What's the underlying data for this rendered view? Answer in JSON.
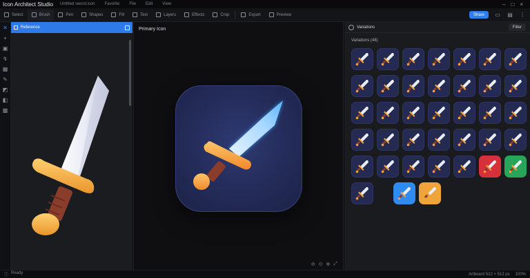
{
  "app": {
    "title": "Icon Architect Studio"
  },
  "menus": [
    "Untitled sword.icon",
    "Favorite",
    "File",
    "Edit",
    "View"
  ],
  "window_controls": [
    "–",
    "□",
    "×"
  ],
  "toolbar": {
    "items": [
      {
        "label": "Select",
        "icon": "cursor-icon"
      },
      {
        "label": "Brush",
        "icon": "brush-icon"
      },
      {
        "label": "Pen",
        "icon": "pen-icon"
      },
      {
        "label": "Shapes",
        "icon": "shapes-icon"
      },
      {
        "label": "Fill",
        "icon": "fill-icon"
      },
      {
        "label": "Text",
        "icon": "text-icon"
      },
      {
        "label": "Layers",
        "icon": "layers-icon"
      },
      {
        "label": "Effects",
        "icon": "effects-icon"
      },
      {
        "label": "Crop",
        "icon": "crop-icon"
      },
      {
        "label": "Export",
        "icon": "export-icon"
      },
      {
        "label": "Preview",
        "icon": "preview-icon"
      }
    ],
    "primary_label": "Share",
    "accent": "#2f7ff3"
  },
  "left_panel": {
    "header": "Reference"
  },
  "center_panel": {
    "title": "Primary Icon",
    "zoom_controls": [
      "⊖",
      "⊙",
      "⊕",
      "⤢"
    ]
  },
  "right_panel": {
    "header": "Variations",
    "button": "Filter",
    "subheader": "Variations (48)",
    "tiles": [
      "navy",
      "navy",
      "navy",
      "navy",
      "navy",
      "navy",
      "navy",
      "navy",
      "navy",
      "navy",
      "navy",
      "navy",
      "navy",
      "navy",
      "navy",
      "navy",
      "navy",
      "navy",
      "navy",
      "navy",
      "navy",
      "navy",
      "navy",
      "navy",
      "navy",
      "navy",
      "navy",
      "navy",
      "navy",
      "navy",
      "navy",
      "navy",
      "navy",
      "red",
      "green",
      "navy",
      "blue",
      "orange"
    ]
  },
  "statusbar": {
    "left": "Ready",
    "right": [
      "Artboard 512 × 512 px",
      "100%"
    ]
  }
}
